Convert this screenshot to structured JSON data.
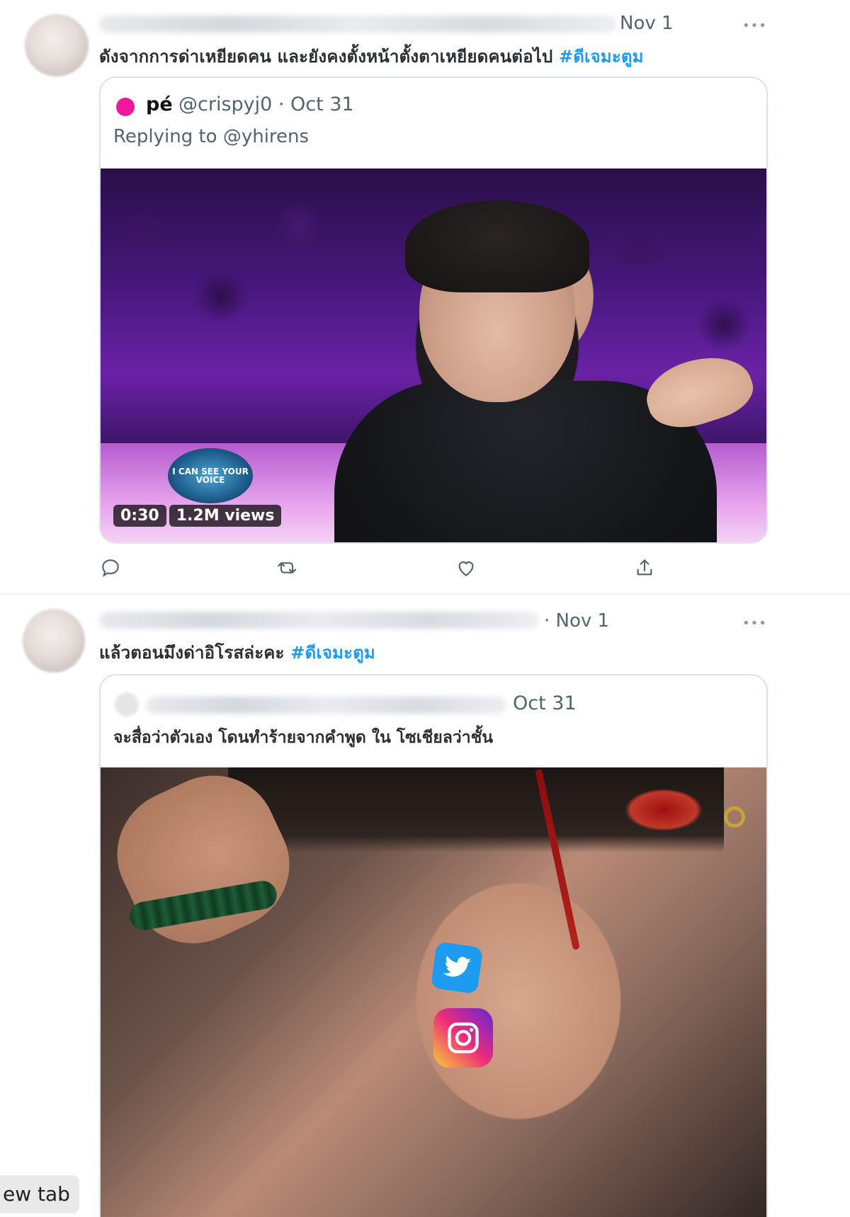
{
  "tweets": [
    {
      "date": "Nov 1",
      "more": "•••",
      "text": "ดังจากการด่าเหยียดคน และยังคงตั้งหน้าตั้งตาเหยียดคนต่อไป",
      "hashtag": "#ดีเจมะตูม",
      "quote": {
        "name": "pé",
        "handle_date": "@crispyj0 · Oct 31",
        "replying_to": "Replying to @yhirens",
        "video": {
          "duration": "0:30",
          "views": "1.2M views",
          "logo_text": "I CAN SEE YOUR VOICE"
        }
      },
      "actions": [
        "reply-icon",
        "retweet-icon",
        "like-icon",
        "share-icon"
      ]
    },
    {
      "date": "· Nov 1",
      "more": "•••",
      "text": "แล้วตอนมึงด่าอิโรสล่ะคะ",
      "hashtag": "#ดีเจมะตูม",
      "quote": {
        "date": "Oct 31",
        "text": "จะสื่อว่าตัวเอง โดนทำร้ายจากคำพูด ใน โซเชียลว่าชั้น",
        "stickers": [
          "twitter-logo-icon",
          "instagram-logo-icon"
        ]
      }
    }
  ],
  "browser": {
    "newtab_tooltip": "ew tab"
  },
  "colors": {
    "accent": "#1d9bf0",
    "quote_avatar": "#f0179a",
    "secondary_text": "#536471"
  }
}
